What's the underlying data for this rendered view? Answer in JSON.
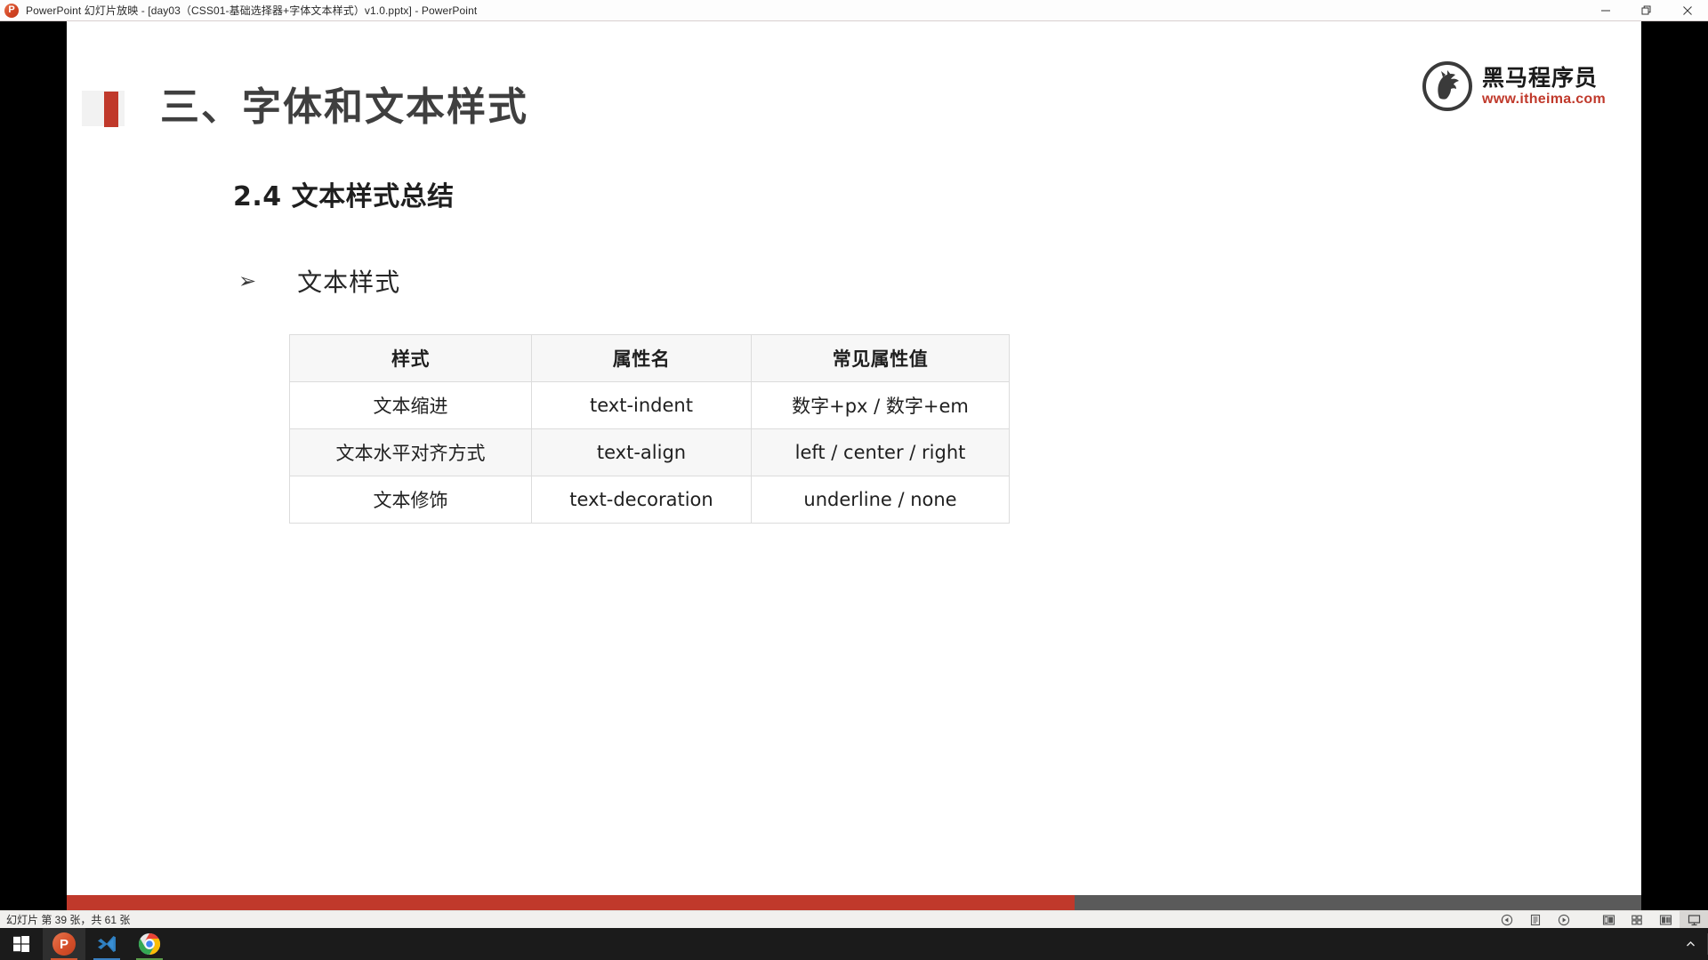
{
  "window": {
    "title": "PowerPoint 幻灯片放映 - [day03（CSS01-基础选择器+字体文本样式）v1.0.pptx] - PowerPoint",
    "app_icon": "powerpoint-icon",
    "controls": {
      "minimize": "minimize-icon",
      "restore": "restore-icon",
      "close": "close-icon"
    }
  },
  "slide": {
    "title": "三、字体和文本样式",
    "section_heading": "2.4 文本样式总结",
    "bullet_marker": "➢",
    "bullet_label": "文本样式",
    "accent_color": "#c0392b",
    "logo": {
      "mark": "horse-logo-icon",
      "name": "黑马程序员",
      "url": "www.itheima.com"
    },
    "table": {
      "headers": [
        "样式",
        "属性名",
        "常见属性值"
      ],
      "rows": [
        [
          "文本缩进",
          "text-indent",
          "数字+px / 数字+em"
        ],
        [
          "文本水平对齐方式",
          "text-align",
          "left / center / right"
        ],
        [
          "文本修饰",
          "text-decoration",
          "underline / none"
        ]
      ]
    }
  },
  "progress": {
    "percent": 64
  },
  "statusbar": {
    "slide_info": "幻灯片 第 39 张，共 61 张",
    "buttons": [
      {
        "name": "previous-slide-button",
        "icon": "chevron-left-circle-icon"
      },
      {
        "name": "pen-notes-button",
        "icon": "notes-page-icon"
      },
      {
        "name": "next-slide-button",
        "icon": "chevron-right-circle-icon"
      },
      {
        "name": "normal-view-button",
        "icon": "normal-view-icon"
      },
      {
        "name": "slide-sorter-button",
        "icon": "slide-sorter-icon"
      },
      {
        "name": "reading-view-button",
        "icon": "reading-view-icon"
      },
      {
        "name": "slideshow-view-button",
        "icon": "slideshow-icon"
      }
    ]
  },
  "taskbar": {
    "start": "windows-start-icon",
    "items": [
      {
        "name": "taskbar-powerpoint",
        "icon": "powerpoint-icon"
      },
      {
        "name": "taskbar-vscode",
        "icon": "vscode-icon"
      },
      {
        "name": "taskbar-chrome",
        "icon": "chrome-icon"
      }
    ],
    "tray": {
      "show_hidden": "chevron-up-icon"
    }
  }
}
